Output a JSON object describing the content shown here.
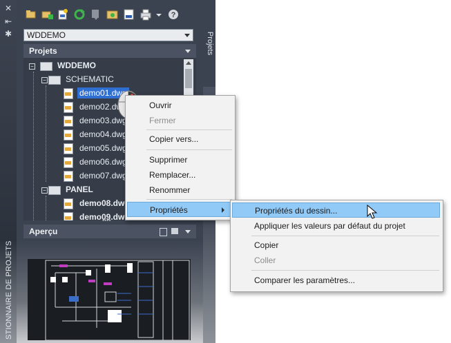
{
  "app": {
    "vertical_title": "STIONNAIRE DE PROJETS",
    "right_tab_label": "Projets"
  },
  "strip_icons": [
    "close-icon",
    "pin-icon",
    "settings-icon"
  ],
  "toolbar": {
    "icons": [
      "open-project-icon",
      "new-project-icon",
      "new-drawing-icon",
      "refresh-icon",
      "task-list-icon",
      "project-wide-update-icon",
      "title-block-update-icon",
      "plot-icon",
      "plot-dropdown-icon",
      "help-icon"
    ]
  },
  "project_selector": {
    "value": "WDDEMO"
  },
  "projects_header": {
    "label": "Projets"
  },
  "tree": [
    {
      "label": "WDDEMO",
      "kind": "project",
      "bold": true
    },
    {
      "label": "SCHEMATIC",
      "kind": "folder"
    },
    {
      "label": "demo01.dwg",
      "kind": "file",
      "selected": true
    },
    {
      "label": "demo02.dwg",
      "kind": "file"
    },
    {
      "label": "demo03.dwg",
      "kind": "file"
    },
    {
      "label": "demo04.dwg",
      "kind": "file"
    },
    {
      "label": "demo05.dwg",
      "kind": "file"
    },
    {
      "label": "demo06.dwg",
      "kind": "file"
    },
    {
      "label": "demo07.dwg",
      "kind": "file"
    },
    {
      "label": "PANEL",
      "kind": "folder",
      "bold": true
    },
    {
      "label": "demo08.dwg",
      "kind": "file",
      "bold": true
    },
    {
      "label": "demo09.dwg",
      "kind": "file",
      "bold": true
    }
  ],
  "preview_header": {
    "label": "Aperçu"
  },
  "context_menu": {
    "items": [
      {
        "label": "Ouvrir",
        "disabled": false
      },
      {
        "label": "Fermer",
        "disabled": true
      },
      {
        "label": "Copier vers...",
        "disabled": false
      },
      {
        "label": "Supprimer",
        "disabled": false
      },
      {
        "label": "Remplacer...",
        "disabled": false
      },
      {
        "label": "Renommer",
        "disabled": false
      },
      {
        "label": "Propriétés",
        "disabled": false,
        "has_submenu": true,
        "highlighted": true
      }
    ]
  },
  "submenu": {
    "items": [
      {
        "label": "Propriétés du dessin...",
        "disabled": false,
        "highlighted": true
      },
      {
        "label": "Appliquer les valeurs par défaut du projet",
        "disabled": false
      },
      {
        "label": "Copier",
        "disabled": false
      },
      {
        "label": "Coller",
        "disabled": true
      },
      {
        "label": "Comparer les paramètres...",
        "disabled": false
      }
    ]
  },
  "colors": {
    "panel_bg": "#3b4250",
    "selection": "#2f6fd1",
    "menu_highlight": "#91c9f7"
  }
}
